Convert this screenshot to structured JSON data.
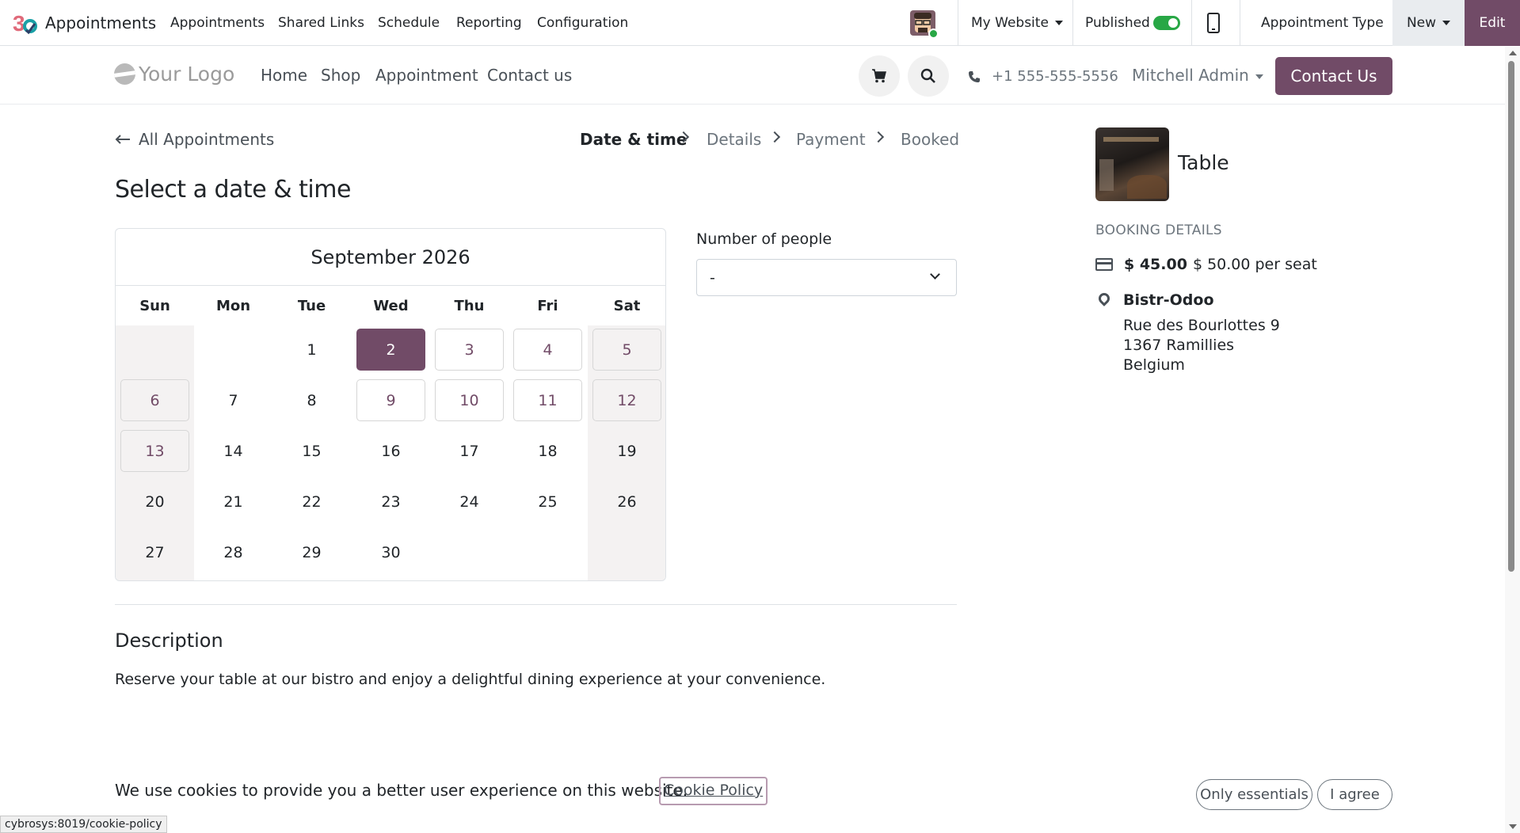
{
  "topbar": {
    "app_name": "Appointments",
    "menus": [
      "Appointments",
      "Shared Links",
      "Schedule",
      "Reporting",
      "Configuration"
    ],
    "website_selector": "My Website",
    "published_label": "Published",
    "published": true,
    "appointment_type_label": "Appointment Type",
    "new_label": "New",
    "edit_label": "Edit"
  },
  "site_header": {
    "logo_text": "Your Logo",
    "nav": [
      "Home",
      "Shop",
      "Appointment",
      "Contact us"
    ],
    "phone": "+1 555-555-5556",
    "user": "Mitchell Admin",
    "contact_button": "Contact Us"
  },
  "main": {
    "back_link": "All Appointments",
    "steps": [
      "Date & time",
      "Details",
      "Payment",
      "Booked"
    ],
    "title": "Select a date & time",
    "calendar": {
      "month": "September 2026",
      "weekdays": [
        "Sun",
        "Mon",
        "Tue",
        "Wed",
        "Thu",
        "Fri",
        "Sat"
      ],
      "selected_day": "2",
      "days": [
        "1",
        "2",
        "3",
        "4",
        "5",
        "6",
        "7",
        "8",
        "9",
        "10",
        "11",
        "12",
        "13",
        "14",
        "15",
        "16",
        "17",
        "18",
        "19",
        "20",
        "21",
        "22",
        "23",
        "24",
        "25",
        "26",
        "27",
        "28",
        "29",
        "30"
      ]
    },
    "people_label": "Number of people",
    "people_value": "-",
    "description_title": "Description",
    "description_text": "Reserve your table at our bistro and enjoy a delightful dining experience at your convenience."
  },
  "sidebar": {
    "appointment_name": "Table",
    "booking_details_label": "BOOKING DETAILS",
    "price_now": "$ 45.00",
    "price_rest": "$ 50.00 per seat",
    "location_name": "Bistr-Odoo",
    "address": [
      "Rue des Bourlottes 9",
      "1367 Ramillies",
      "Belgium"
    ]
  },
  "cookie_bar": {
    "text": "We use cookies to provide you a better user experience on this website.",
    "policy_link": "Cookie Policy",
    "only_essentials": "Only essentials",
    "agree": "I agree"
  },
  "status_url": "cybrosys:8019/cookie-policy",
  "colors": {
    "brand": "#714b67",
    "published_toggle": "#28a745",
    "weekend_bg": "#f4f2f2"
  }
}
